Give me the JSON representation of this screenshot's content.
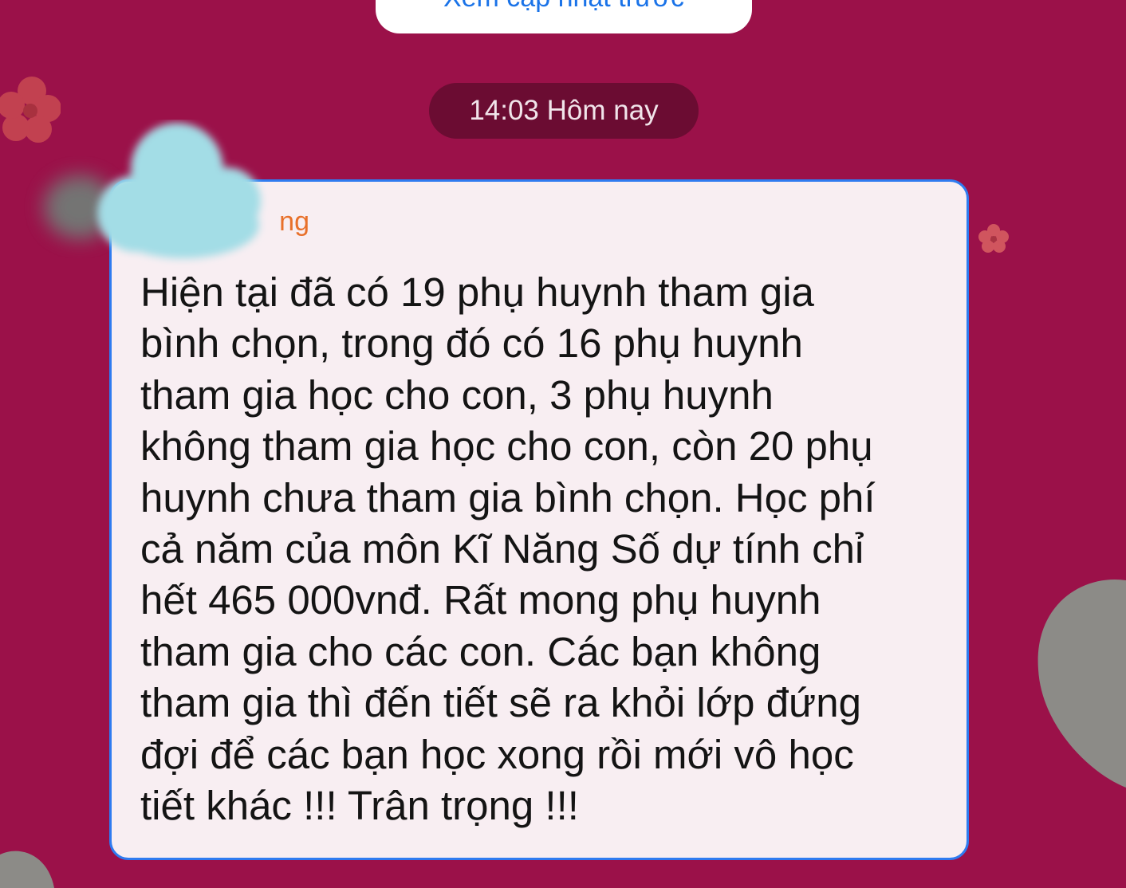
{
  "top_button": {
    "label": "Xem cập nhật trước"
  },
  "timestamp": {
    "label": "14:03 Hôm nay"
  },
  "message": {
    "sender": "ng",
    "lines": [
      "Hiện tại đã có 19 phụ huynh tham gia",
      "bình chọn, trong đó có 16 phụ huynh",
      "tham gia học cho con, 3 phụ huynh",
      "không tham gia học cho con, còn 20 phụ",
      "huynh chưa tham gia bình chọn. Học phí",
      "cả năm của môn Kĩ Năng Số dự tính chỉ",
      "hết 465 000vnđ. Rất mong phụ huynh",
      "tham gia cho các con. Các bạn không",
      "tham gia thì đến tiết sẽ ra khỏi lớp đứng",
      "đợi để các bạn học xong rồi mới vô học",
      "tiết khác !!! Trân trọng !!!"
    ]
  },
  "colors": {
    "background": "#9b1149",
    "bubble": "#f8eef2",
    "bubble_border": "#2f7bf0",
    "sender": "#e8702a",
    "link": "#1a73e8"
  },
  "icons": [
    "blossom-icon",
    "privacy-blur-cloud"
  ]
}
